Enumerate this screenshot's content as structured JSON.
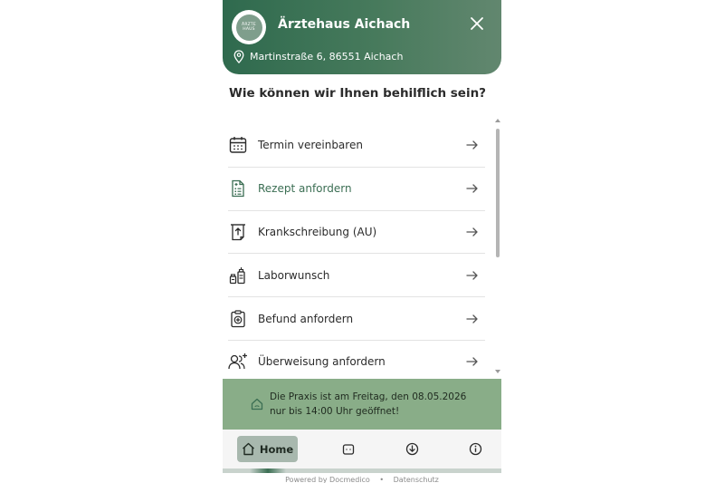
{
  "header": {
    "logo_text_1": "ÄRZTE",
    "logo_text_2": "HAUS",
    "title": "Ärztehaus Aichach",
    "address": "Martinstraße 6, 86551 Aichach"
  },
  "question": "Wie können wir Ihnen behilflich sein?",
  "menu": {
    "items": [
      {
        "label": "Termin vereinbaren",
        "icon": "calendar-icon"
      },
      {
        "label": "Rezept anfordern",
        "icon": "prescription-icon"
      },
      {
        "label": "Krankschreibung (AU)",
        "icon": "sick-note-icon"
      },
      {
        "label": "Laborwunsch",
        "icon": "lab-icon"
      },
      {
        "label": "Befund anfordern",
        "icon": "report-icon"
      },
      {
        "label": "Überweisung anfordern",
        "icon": "referral-icon"
      }
    ]
  },
  "notice": {
    "text": "Die Praxis ist am Freitag, den 08.05.2026 nur bis 14:00 Uhr geöffnet!"
  },
  "tabbar": {
    "home_label": "Home"
  },
  "footer": {
    "powered": "Powered by Docmedico",
    "separator": "•",
    "privacy": "Datenschutz"
  },
  "colors": {
    "header_green": "#2f6a4e",
    "notice_green": "#89ad88",
    "active_text": "#3b6e53",
    "tab_active_bg": "#a8b8ae"
  }
}
